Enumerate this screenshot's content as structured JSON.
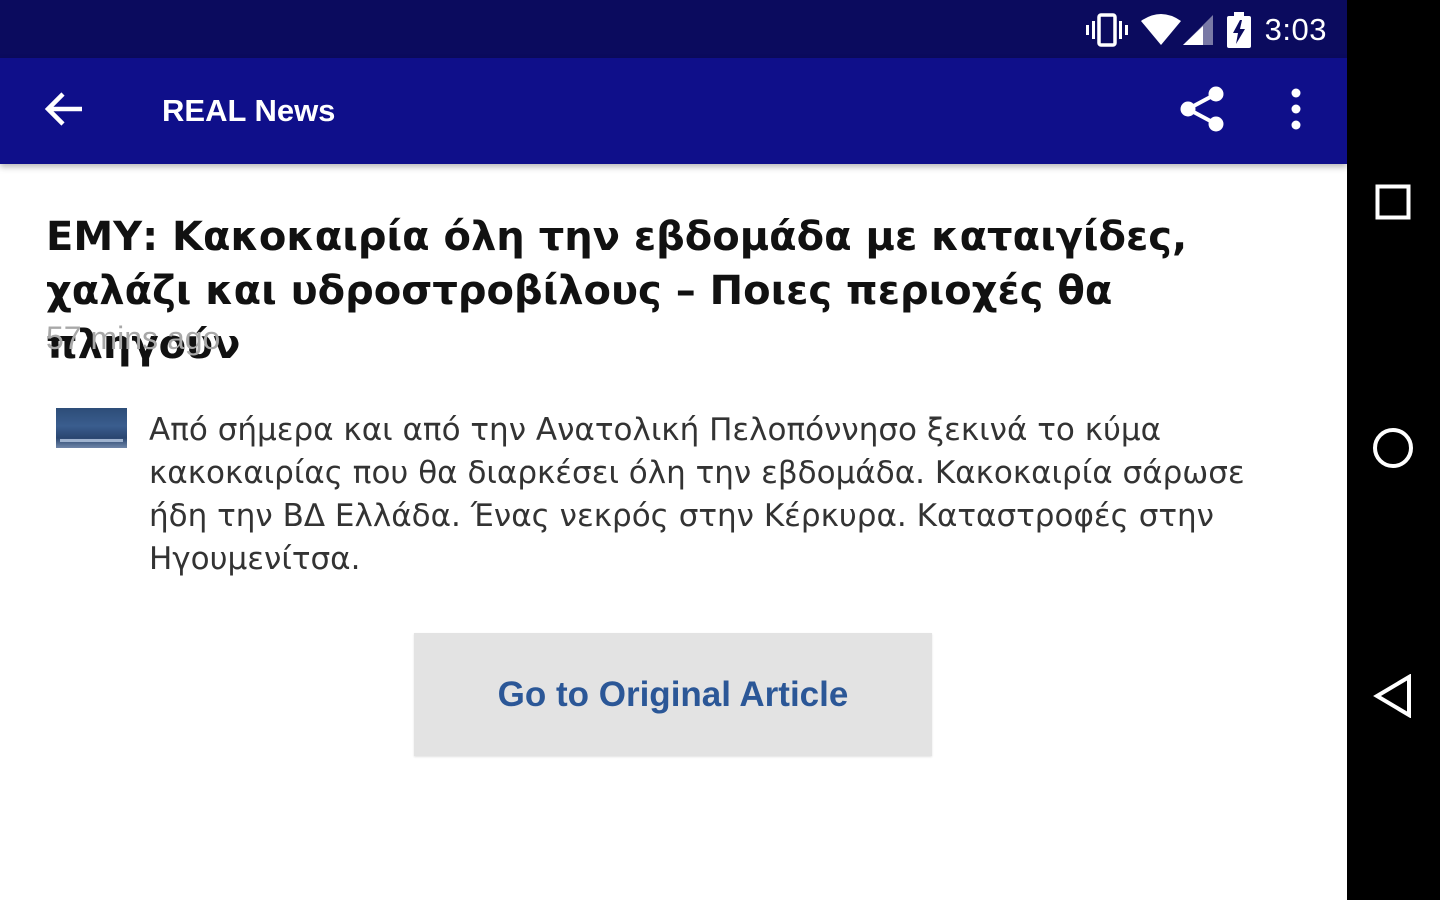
{
  "status_bar": {
    "time": "3:03",
    "icons": [
      "vibrate-icon",
      "wifi-icon",
      "cell-signal-icon",
      "battery-charging-icon"
    ],
    "background": "#0b0b5e"
  },
  "app_bar": {
    "title": "REAL News",
    "background": "#0f0f8a",
    "icons": [
      "back-arrow-icon",
      "share-icon",
      "more-vert-icon"
    ]
  },
  "article": {
    "title": "ΕΜΥ: Κακοκαιρία όλη την εβδομάδα με καταιγίδες, χαλάζι και υδροστροβίλους – Ποιες περιοχές θα πληγούν",
    "time_ago": "57 mins ago",
    "summary": "Από σήμερα και από την Ανατολική Πελοπόννησο ξεκινά το κύμα κακοκαιρίας που θα διαρκέσει όλη την εβδομάδα. Κακοκαιρία σάρωσε ήδη την ΒΔ Ελλάδα. Ένας νεκρός στην Κέρκυρα. Καταστροφές στην Ηγουμενίτσα."
  },
  "actions": {
    "original_article_label": "Go to Original Article",
    "label_color": "#2b5797"
  },
  "nav_bar": {
    "icons": [
      "recents-square-icon",
      "home-circle-icon",
      "back-triangle-icon"
    ]
  }
}
